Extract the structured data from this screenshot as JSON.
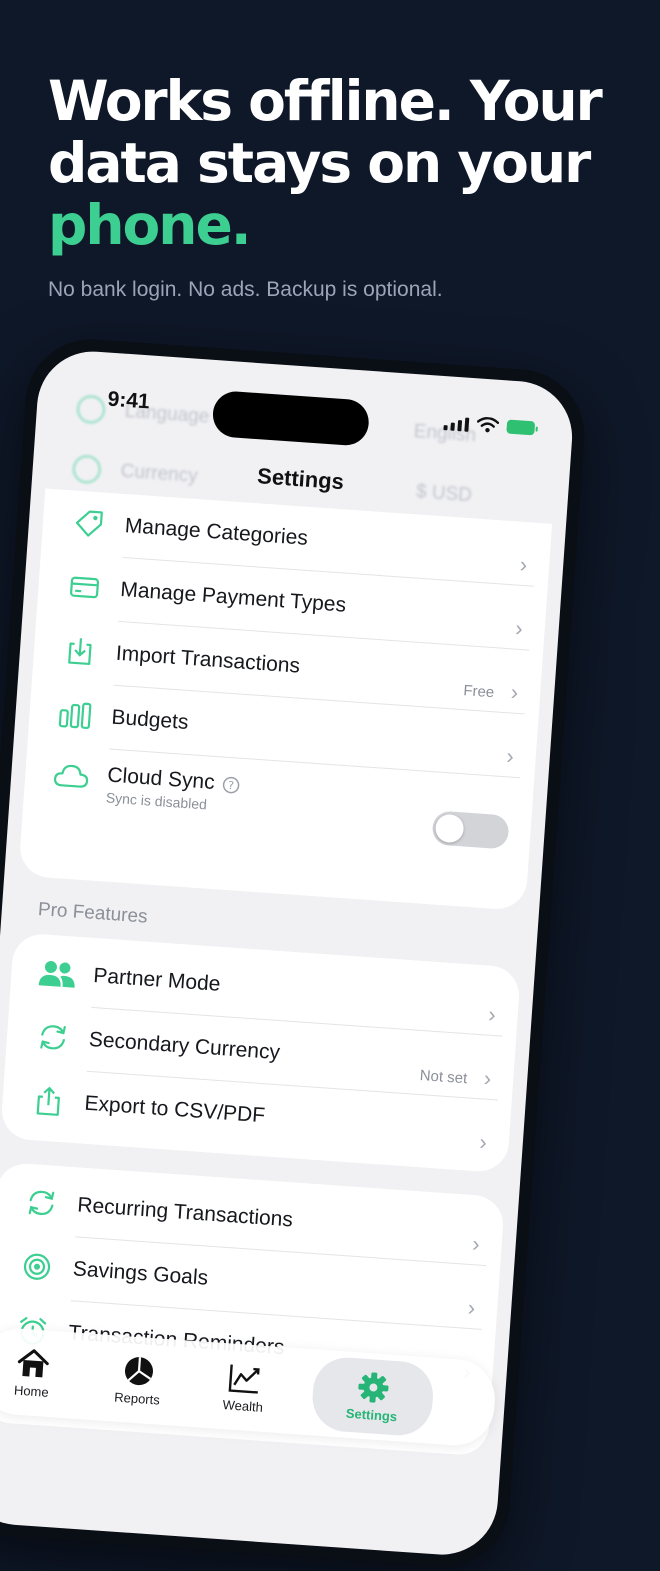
{
  "headline": {
    "line1": "Works offline. Your",
    "line2": "data stays on your",
    "accent": "phone.",
    "subtitle": "No bank login. No ads. Backup is optional."
  },
  "status_bar": {
    "time": "9:41"
  },
  "nav": {
    "title": "Settings"
  },
  "faded_rows": [
    {
      "label": "Language",
      "value": "English"
    },
    {
      "label": "Currency",
      "value": "$ USD"
    }
  ],
  "general": [
    {
      "label": "Manage Categories",
      "icon": "tag-icon"
    },
    {
      "label": "Manage Payment Types",
      "icon": "credit-card-icon"
    },
    {
      "label": "Import Transactions",
      "icon": "download-icon",
      "value": "Free"
    },
    {
      "label": "Budgets",
      "icon": "bar-chart-icon"
    },
    {
      "label": "Cloud Sync",
      "icon": "cloud-icon",
      "sub": "Sync is disabled",
      "toggle": false
    }
  ],
  "pro_section": {
    "title": "Pro Features",
    "items": [
      {
        "label": "Partner Mode",
        "icon": "users-icon"
      },
      {
        "label": "Secondary Currency",
        "icon": "refresh-icon",
        "value": "Not set"
      },
      {
        "label": "Export to CSV/PDF",
        "icon": "share-icon"
      }
    ]
  },
  "more": [
    {
      "label": "Recurring Transactions",
      "icon": "recurring-icon"
    },
    {
      "label": "Savings Goals",
      "icon": "target-icon"
    },
    {
      "label": "Transaction Reminders",
      "icon": "alarm-clock-icon"
    }
  ],
  "tabbar": [
    {
      "label": "Home",
      "icon": "home-icon"
    },
    {
      "label": "Reports",
      "icon": "pie-chart-icon"
    },
    {
      "label": "Wealth",
      "icon": "line-chart-icon"
    },
    {
      "label": "Settings",
      "icon": "gear-icon",
      "active": true
    }
  ],
  "colors": {
    "background": "#0f1829",
    "accent": "#3ccf91",
    "screen": "#f1f1f4"
  }
}
